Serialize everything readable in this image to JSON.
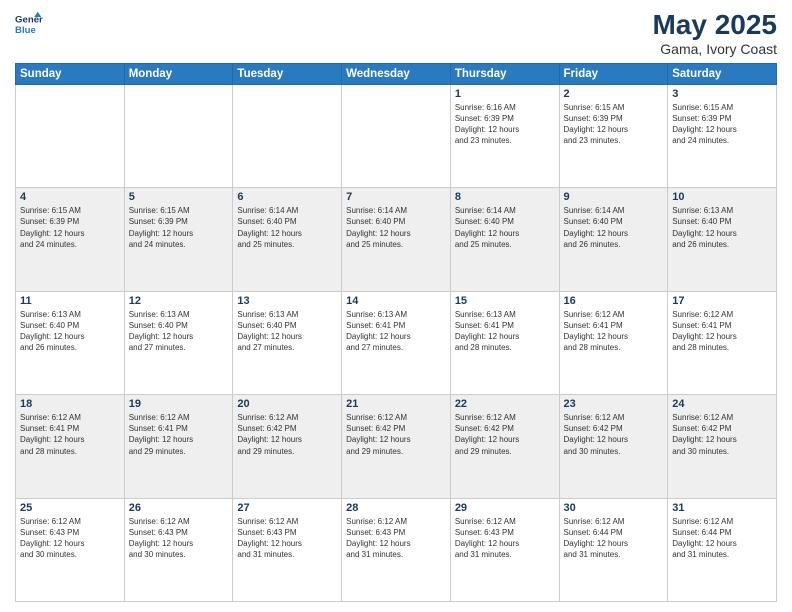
{
  "header": {
    "logo_line1": "General",
    "logo_line2": "Blue",
    "title": "May 2025",
    "subtitle": "Gama, Ivory Coast"
  },
  "days_of_week": [
    "Sunday",
    "Monday",
    "Tuesday",
    "Wednesday",
    "Thursday",
    "Friday",
    "Saturday"
  ],
  "weeks": [
    [
      {
        "day": "",
        "info": ""
      },
      {
        "day": "",
        "info": ""
      },
      {
        "day": "",
        "info": ""
      },
      {
        "day": "",
        "info": ""
      },
      {
        "day": "1",
        "info": "Sunrise: 6:16 AM\nSunset: 6:39 PM\nDaylight: 12 hours\nand 23 minutes."
      },
      {
        "day": "2",
        "info": "Sunrise: 6:15 AM\nSunset: 6:39 PM\nDaylight: 12 hours\nand 23 minutes."
      },
      {
        "day": "3",
        "info": "Sunrise: 6:15 AM\nSunset: 6:39 PM\nDaylight: 12 hours\nand 24 minutes."
      }
    ],
    [
      {
        "day": "4",
        "info": "Sunrise: 6:15 AM\nSunset: 6:39 PM\nDaylight: 12 hours\nand 24 minutes."
      },
      {
        "day": "5",
        "info": "Sunrise: 6:15 AM\nSunset: 6:39 PM\nDaylight: 12 hours\nand 24 minutes."
      },
      {
        "day": "6",
        "info": "Sunrise: 6:14 AM\nSunset: 6:40 PM\nDaylight: 12 hours\nand 25 minutes."
      },
      {
        "day": "7",
        "info": "Sunrise: 6:14 AM\nSunset: 6:40 PM\nDaylight: 12 hours\nand 25 minutes."
      },
      {
        "day": "8",
        "info": "Sunrise: 6:14 AM\nSunset: 6:40 PM\nDaylight: 12 hours\nand 25 minutes."
      },
      {
        "day": "9",
        "info": "Sunrise: 6:14 AM\nSunset: 6:40 PM\nDaylight: 12 hours\nand 26 minutes."
      },
      {
        "day": "10",
        "info": "Sunrise: 6:13 AM\nSunset: 6:40 PM\nDaylight: 12 hours\nand 26 minutes."
      }
    ],
    [
      {
        "day": "11",
        "info": "Sunrise: 6:13 AM\nSunset: 6:40 PM\nDaylight: 12 hours\nand 26 minutes."
      },
      {
        "day": "12",
        "info": "Sunrise: 6:13 AM\nSunset: 6:40 PM\nDaylight: 12 hours\nand 27 minutes."
      },
      {
        "day": "13",
        "info": "Sunrise: 6:13 AM\nSunset: 6:40 PM\nDaylight: 12 hours\nand 27 minutes."
      },
      {
        "day": "14",
        "info": "Sunrise: 6:13 AM\nSunset: 6:41 PM\nDaylight: 12 hours\nand 27 minutes."
      },
      {
        "day": "15",
        "info": "Sunrise: 6:13 AM\nSunset: 6:41 PM\nDaylight: 12 hours\nand 28 minutes."
      },
      {
        "day": "16",
        "info": "Sunrise: 6:12 AM\nSunset: 6:41 PM\nDaylight: 12 hours\nand 28 minutes."
      },
      {
        "day": "17",
        "info": "Sunrise: 6:12 AM\nSunset: 6:41 PM\nDaylight: 12 hours\nand 28 minutes."
      }
    ],
    [
      {
        "day": "18",
        "info": "Sunrise: 6:12 AM\nSunset: 6:41 PM\nDaylight: 12 hours\nand 28 minutes."
      },
      {
        "day": "19",
        "info": "Sunrise: 6:12 AM\nSunset: 6:41 PM\nDaylight: 12 hours\nand 29 minutes."
      },
      {
        "day": "20",
        "info": "Sunrise: 6:12 AM\nSunset: 6:42 PM\nDaylight: 12 hours\nand 29 minutes."
      },
      {
        "day": "21",
        "info": "Sunrise: 6:12 AM\nSunset: 6:42 PM\nDaylight: 12 hours\nand 29 minutes."
      },
      {
        "day": "22",
        "info": "Sunrise: 6:12 AM\nSunset: 6:42 PM\nDaylight: 12 hours\nand 29 minutes."
      },
      {
        "day": "23",
        "info": "Sunrise: 6:12 AM\nSunset: 6:42 PM\nDaylight: 12 hours\nand 30 minutes."
      },
      {
        "day": "24",
        "info": "Sunrise: 6:12 AM\nSunset: 6:42 PM\nDaylight: 12 hours\nand 30 minutes."
      }
    ],
    [
      {
        "day": "25",
        "info": "Sunrise: 6:12 AM\nSunset: 6:43 PM\nDaylight: 12 hours\nand 30 minutes."
      },
      {
        "day": "26",
        "info": "Sunrise: 6:12 AM\nSunset: 6:43 PM\nDaylight: 12 hours\nand 30 minutes."
      },
      {
        "day": "27",
        "info": "Sunrise: 6:12 AM\nSunset: 6:43 PM\nDaylight: 12 hours\nand 31 minutes."
      },
      {
        "day": "28",
        "info": "Sunrise: 6:12 AM\nSunset: 6:43 PM\nDaylight: 12 hours\nand 31 minutes."
      },
      {
        "day": "29",
        "info": "Sunrise: 6:12 AM\nSunset: 6:43 PM\nDaylight: 12 hours\nand 31 minutes."
      },
      {
        "day": "30",
        "info": "Sunrise: 6:12 AM\nSunset: 6:44 PM\nDaylight: 12 hours\nand 31 minutes."
      },
      {
        "day": "31",
        "info": "Sunrise: 6:12 AM\nSunset: 6:44 PM\nDaylight: 12 hours\nand 31 minutes."
      }
    ]
  ]
}
